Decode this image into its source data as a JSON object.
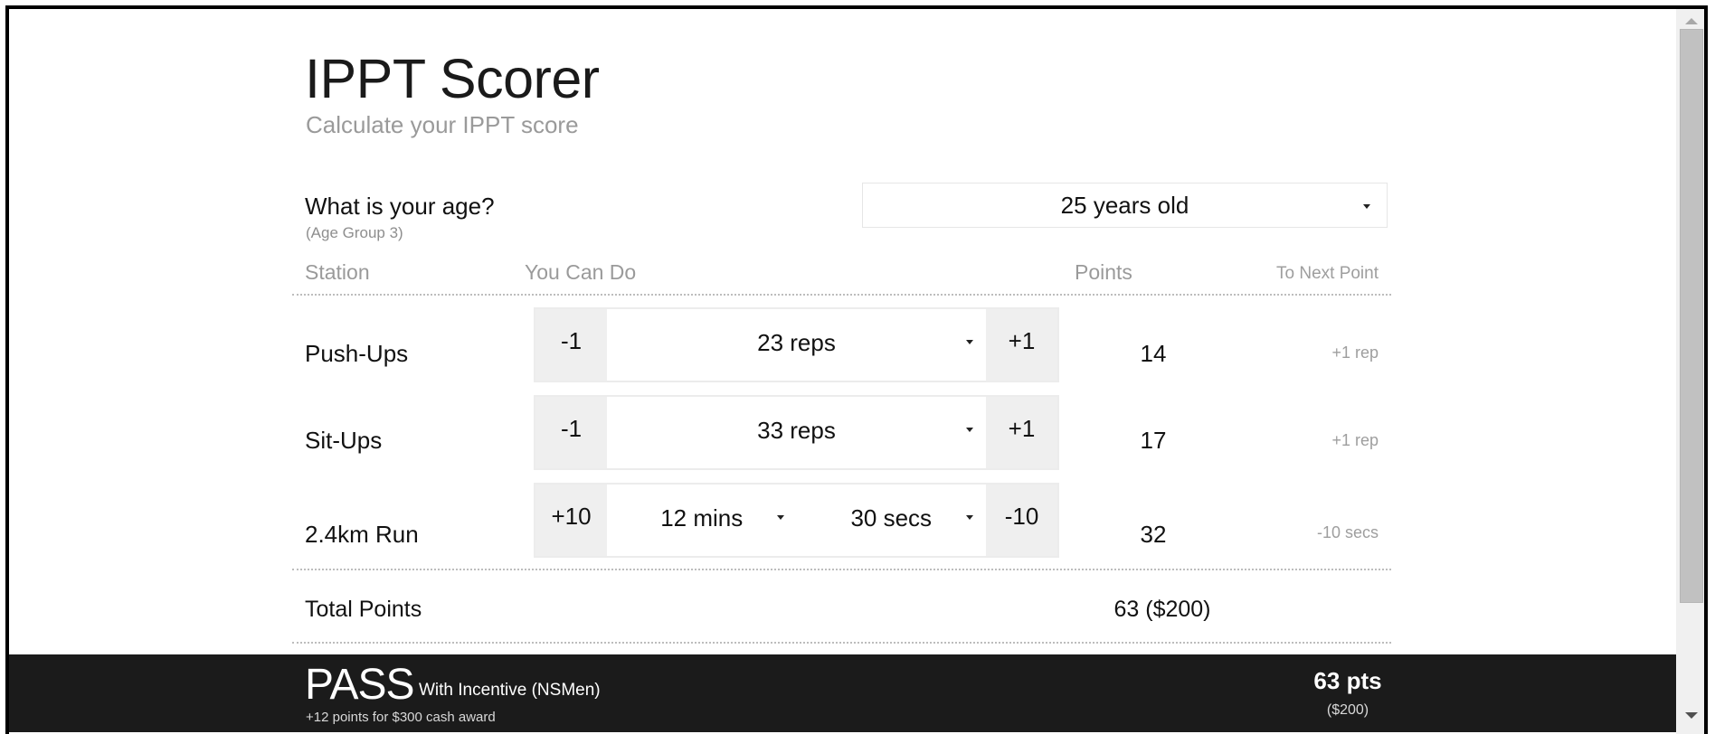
{
  "header": {
    "title": "IPPT Scorer",
    "subtitle": "Calculate your IPPT score"
  },
  "age": {
    "question": "What is your age?",
    "group": "(Age Group 3)",
    "selected": "25 years old"
  },
  "table": {
    "headers": {
      "station": "Station",
      "you_can_do": "You Can Do",
      "points": "Points",
      "to_next_point": "To Next Point"
    },
    "rows": [
      {
        "station": "Push-Ups",
        "decrement": "-1",
        "value": "23 reps",
        "increment": "+1",
        "points": "14",
        "to_next": "+1 rep"
      },
      {
        "station": "Sit-Ups",
        "decrement": "-1",
        "value": "33 reps",
        "increment": "+1",
        "points": "17",
        "to_next": "+1 rep"
      },
      {
        "station": "2.4km Run",
        "decrement": "+10",
        "minutes": "12 mins",
        "seconds": "30 secs",
        "increment": "-10",
        "points": "32",
        "to_next": "-10 secs"
      }
    ],
    "total": {
      "label": "Total Points",
      "value": "63 ($200)"
    }
  },
  "footer": {
    "result": "PASS",
    "result_detail": "With Incentive (NSMen)",
    "note": "+12 points for $300 cash award",
    "points": "63 pts",
    "money": "($200)",
    "background_color": "#1b1b1b"
  }
}
